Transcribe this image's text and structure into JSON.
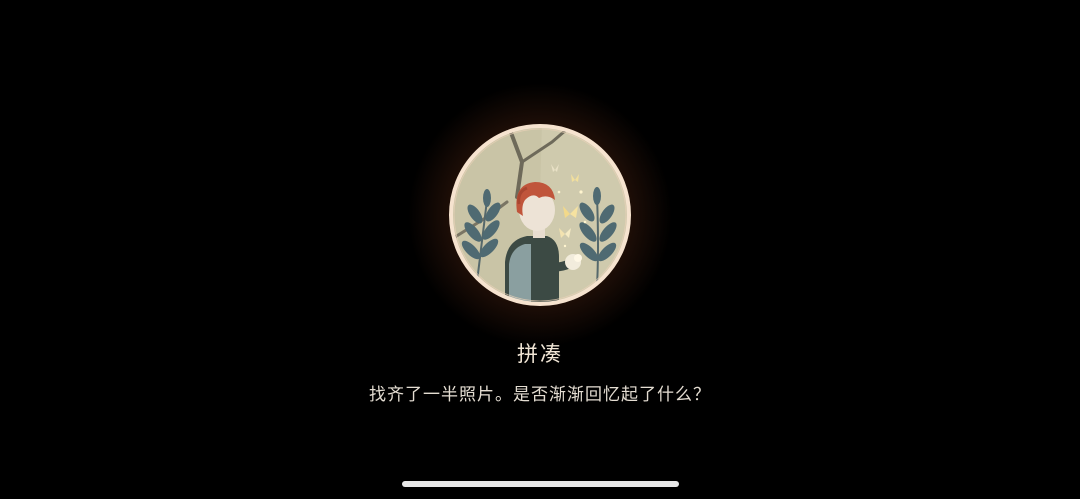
{
  "achievement": {
    "title": "拼凑",
    "description": "找齐了一半照片。是否渐渐回忆起了什么？"
  },
  "badge": {
    "icon": "boy-with-butterflies-badge-icon",
    "ring_color": "#f6e3cf",
    "glow_color": "#c8703f",
    "background_color": "#c9c4a6"
  },
  "colors": {
    "screen_background": "#000000",
    "title_text": "#f1e6d6",
    "description_text": "#e4ddd2",
    "home_indicator": "#e8e8e8"
  }
}
